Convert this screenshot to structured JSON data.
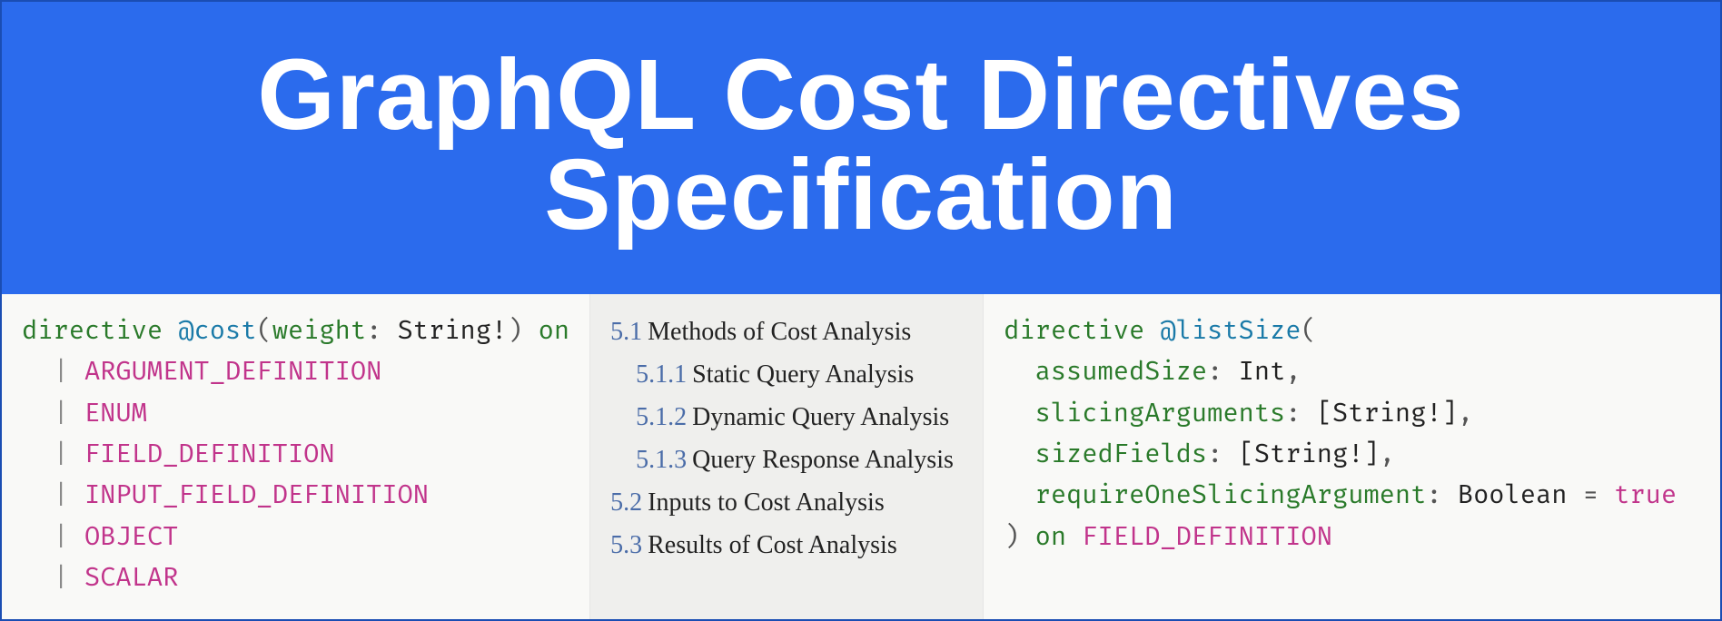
{
  "banner": {
    "title": "GraphQL Cost Directives Specification"
  },
  "costDirective": {
    "keyword": "directive",
    "name": "@cost",
    "arg": "weight",
    "argType": "String!",
    "on": "on",
    "locations": [
      "ARGUMENT_DEFINITION",
      "ENUM",
      "FIELD_DEFINITION",
      "INPUT_FIELD_DEFINITION",
      "OBJECT",
      "SCALAR"
    ]
  },
  "toc": {
    "s1": {
      "num": "5.1",
      "label": "Methods of Cost Analysis"
    },
    "s1_1": {
      "num": "5.1.1",
      "label": "Static Query Analysis"
    },
    "s1_2": {
      "num": "5.1.2",
      "label": "Dynamic Query Analysis"
    },
    "s1_3": {
      "num": "5.1.3",
      "label": "Query Response Analysis"
    },
    "s2": {
      "num": "5.2",
      "label": "Inputs to Cost Analysis"
    },
    "s3": {
      "num": "5.3",
      "label": "Results of Cost Analysis"
    }
  },
  "listSizeDirective": {
    "keyword": "directive",
    "name": "@listSize",
    "args": {
      "assumedSize": {
        "name": "assumedSize",
        "type": "Int"
      },
      "slicingArguments": {
        "name": "slicingArguments",
        "type": "[String!]"
      },
      "sizedFields": {
        "name": "sizedFields",
        "type": "[String!]"
      },
      "requireOneSlicingArgument": {
        "name": "requireOneSlicingArgument",
        "type": "Boolean",
        "default": "true"
      }
    },
    "on": "on",
    "location": "FIELD_DEFINITION"
  }
}
